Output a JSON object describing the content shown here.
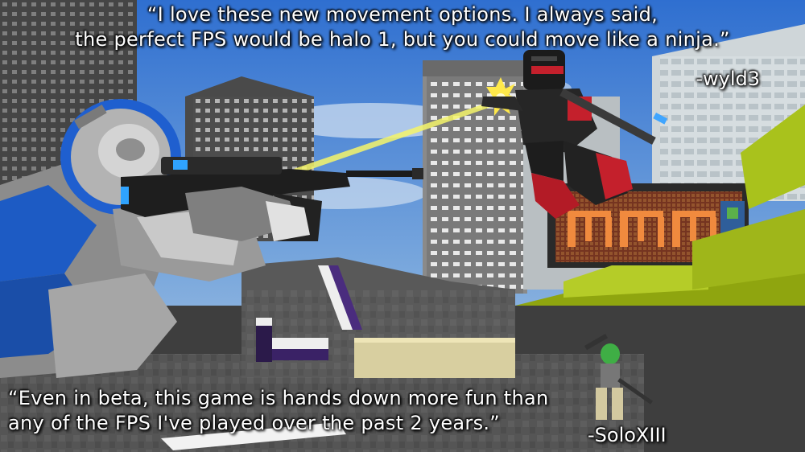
{
  "scene": {
    "description_icons": [
      "sniper-player",
      "jetpack-player",
      "city-towers",
      "mm-sign",
      "hazard-blocks"
    ],
    "colors": {
      "sky": "#5d8fd0",
      "sniper_armor": "#1d5bc4",
      "enemy_armor": "#cc1f2b",
      "laser": "#f4f46a",
      "muzzle_flash": "#ffe94a",
      "mm_sign": "#e5612a",
      "green_blocks": "#a9c21c"
    }
  },
  "top_quote": {
    "line1": "“I love these new movement options. I always said,",
    "line2": "the perfect FPS would be halo 1, but you could move like a ninja.”",
    "attribution": "-wyld3"
  },
  "bottom_quote": {
    "line1": "“Even in beta, this game is hands down more fun than",
    "line2": "any of the FPS I've played over the past 2 years.”",
    "attribution": "-SoloXIII"
  }
}
